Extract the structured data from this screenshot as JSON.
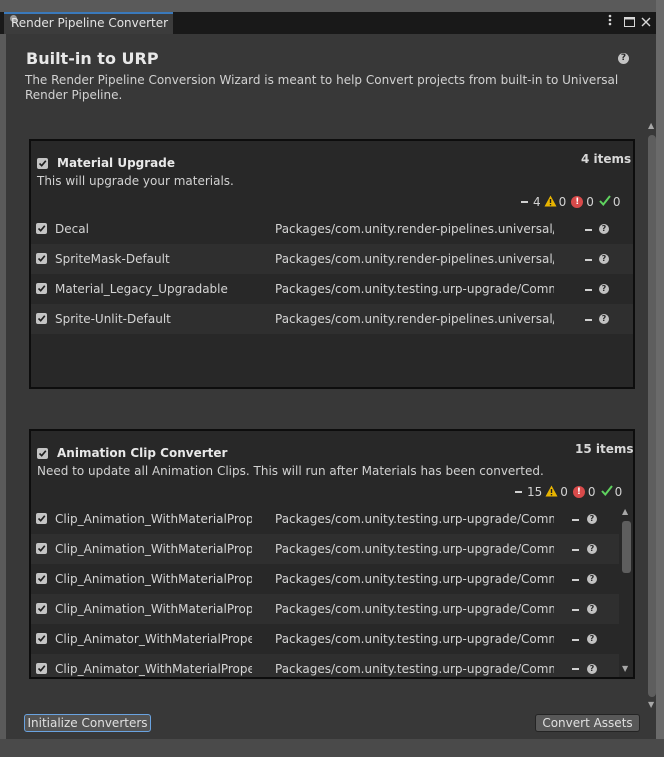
{
  "window": {
    "tab_title": "Render Pipeline Converter",
    "menu_icon": "kebab-menu-icon",
    "maximize_icon": "maximize-icon",
    "close_icon": "close-icon"
  },
  "header": {
    "title": "Built-in to URP",
    "help_icon": "help-icon",
    "description": "The Render Pipeline Conversion Wizard is meant to help Convert projects from built-in to Universal Render Pipeline."
  },
  "sections": [
    {
      "title": "Material Upgrade",
      "count_label": "4 items",
      "description": "This will upgrade your materials.",
      "checked": true,
      "status": {
        "pending": "4",
        "warnings": "0",
        "errors": "0",
        "success": "0"
      },
      "items": [
        {
          "name": "Decal",
          "path": "Packages/com.unity.render-pipelines.universal/Runtime/Materials/Decal.mat",
          "checked": true
        },
        {
          "name": "SpriteMask-Default",
          "path": "Packages/com.unity.render-pipelines.universal/Runtime/Materials/SpriteMask-Default.mat",
          "checked": true
        },
        {
          "name": "Material_Legacy_Upgradable",
          "path": "Packages/com.unity.testing.urp-upgrade/Common/Materials/Material_Legacy_Upgradable.mat",
          "checked": true
        },
        {
          "name": "Sprite-Unlit-Default",
          "path": "Packages/com.unity.render-pipelines.universal/Runtime/Materials/Sprite-Unlit-Default.mat",
          "checked": true
        }
      ]
    },
    {
      "title": "Animation Clip Converter",
      "count_label": "15 items",
      "description": "Need to update all Animation Clips. This will run after Materials has been converted.",
      "checked": true,
      "status": {
        "pending": "15",
        "warnings": "0",
        "errors": "0",
        "success": "0"
      },
      "items": [
        {
          "name": "Clip_Animation_WithMaterialProperties",
          "path": "Packages/com.unity.testing.urp-upgrade/Common/Animation/Clip_Animation_WithMaterialProperties.anim",
          "checked": true
        },
        {
          "name": "Clip_Animation_WithMaterialProperties",
          "path": "Packages/com.unity.testing.urp-upgrade/Common/Animation/Clip_Animation_WithMaterialProperties.anim",
          "checked": true
        },
        {
          "name": "Clip_Animation_WithMaterialProperties",
          "path": "Packages/com.unity.testing.urp-upgrade/Common/Animation/Clip_Animation_WithMaterialProperties.anim",
          "checked": true
        },
        {
          "name": "Clip_Animation_WithMaterialProperties",
          "path": "Packages/com.unity.testing.urp-upgrade/Common/Animation/Clip_Animation_WithMaterialProperties.anim",
          "checked": true
        },
        {
          "name": "Clip_Animator_WithMaterialProperties",
          "path": "Packages/com.unity.testing.urp-upgrade/Common/Animation/Clip_Animator_WithMaterialProperties.anim",
          "checked": true
        },
        {
          "name": "Clip_Animator_WithMaterialProperties",
          "path": "Packages/com.unity.testing.urp-upgrade/Common/Animation/Clip_Animator_WithMaterialProperties.anim",
          "checked": true
        }
      ]
    }
  ],
  "footer": {
    "initialize_label": "Initialize Converters",
    "convert_label": "Convert Assets"
  },
  "colors": {
    "window_bg": "#383838",
    "panel_bg": "#282828",
    "accent_focus": "#6aa3e0",
    "warning": "#e8b400",
    "error": "#d84a4a",
    "success": "#5fd35f"
  }
}
